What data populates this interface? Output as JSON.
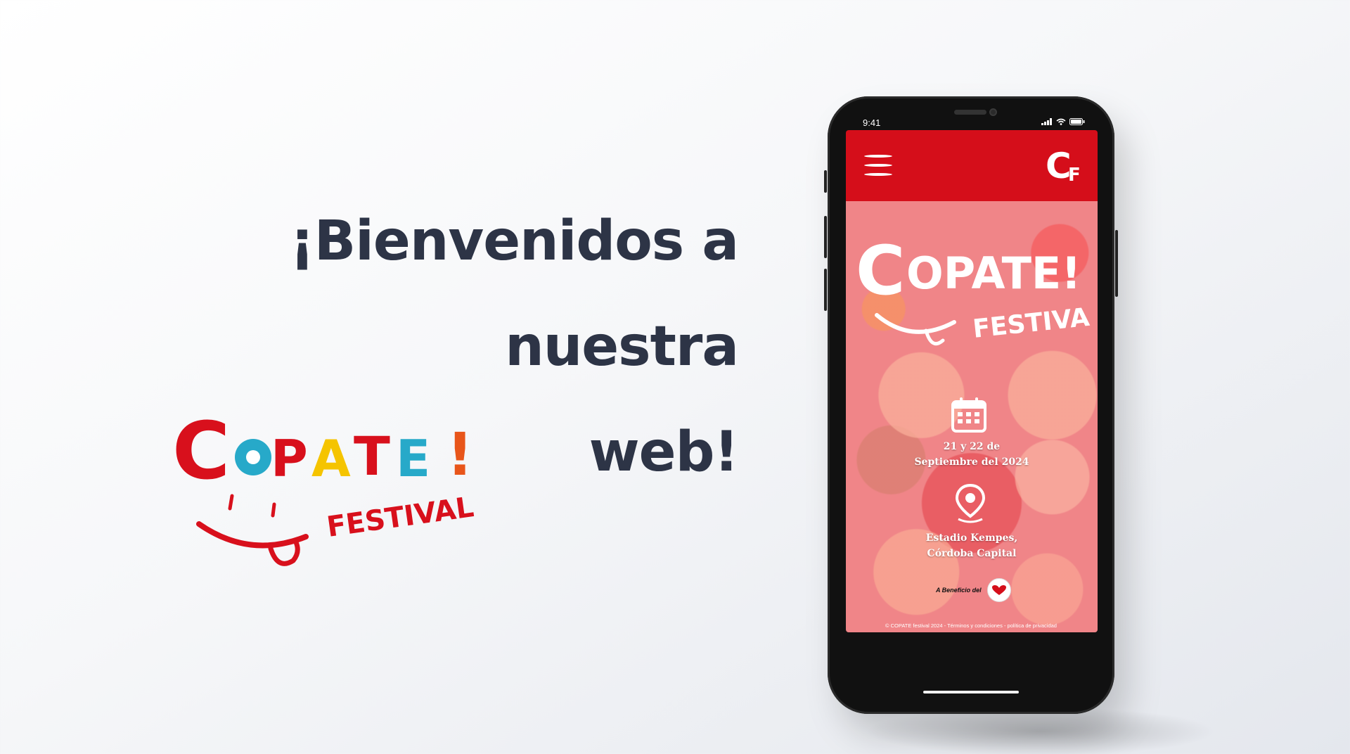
{
  "headline": {
    "line1": "¡Bienvenidos a nuestra",
    "line2": "web!"
  },
  "logo": {
    "word": "COPATE!",
    "sub": "FESTIVAL"
  },
  "colors": {
    "brand_red": "#d50e1a",
    "headline": "#2d3446",
    "hero_pink": "#f08c8e"
  },
  "phone": {
    "status": {
      "time": "9:41",
      "icons": [
        "signal-icon",
        "wifi-icon",
        "battery-icon"
      ]
    },
    "header": {
      "menu_icon": "hamburger-menu-icon",
      "brand_mark": "Cf"
    },
    "hero": {
      "logo_word": "COPATE!",
      "logo_sub": "FESTIVAL",
      "date_icon": "calendar-icon",
      "date_line1": "21 y 22 de",
      "date_line2": "Septiembre del 2024",
      "location_icon": "map-pin-icon",
      "location_line1": "Estadio Kempes,",
      "location_line2": "Córdoba Capital",
      "benefit_text": "A Beneficio del"
    },
    "footer": {
      "text": "© COPATE festival  2024 - Términos y condiciones - política de privacidad"
    }
  }
}
